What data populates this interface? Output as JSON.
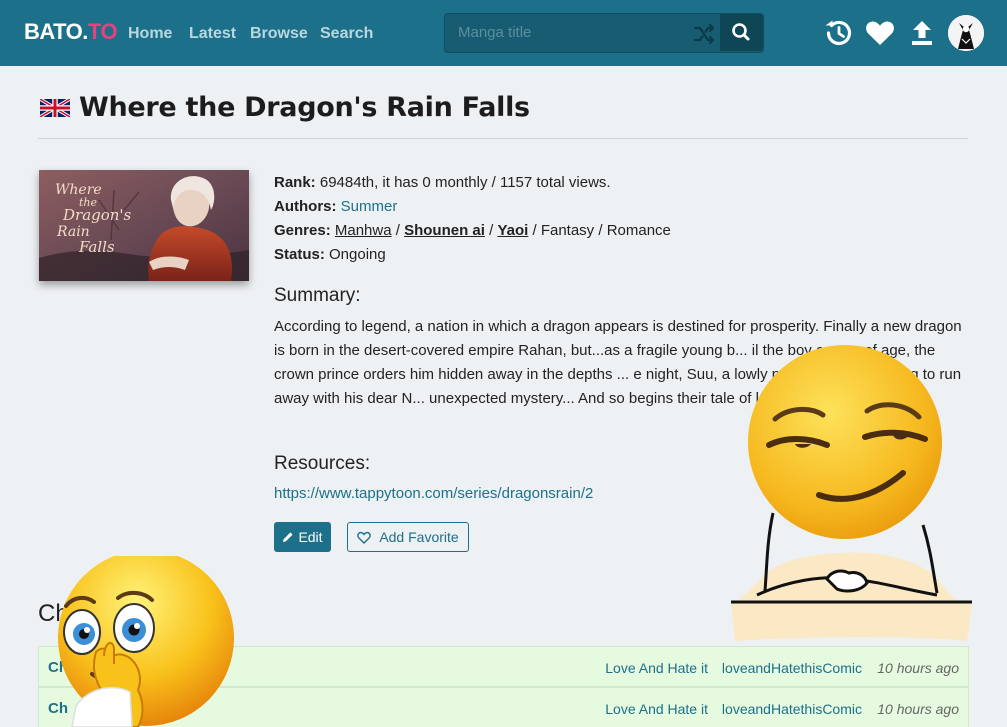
{
  "header": {
    "logo_a": "BATO.",
    "logo_b": "TO",
    "nav": [
      "Home",
      "Latest",
      "Browse",
      "Search"
    ],
    "search_placeholder": "Manga title",
    "icons": [
      "history-icon",
      "heart-icon",
      "upload-icon"
    ]
  },
  "manga": {
    "title": "Where the Dragon's Rain Falls",
    "flag": "uk-flag",
    "cover_text": [
      "Where",
      "the",
      "Dragon's",
      "Rain",
      "Falls"
    ],
    "rank_label": "Rank:",
    "rank_value": "69484th, it has 0 monthly / 1157 total views.",
    "authors_label": "Authors:",
    "author": "Summer",
    "genres_label": "Genres:",
    "genres": [
      "Manhwa",
      "Shounen ai",
      "Yaoi",
      "Fantasy",
      "Romance"
    ],
    "genre_sep": " / ",
    "status_label": "Status:",
    "status": "Ongoing",
    "summary_heading": "Summary:",
    "summary": "According to legend, a nation in which a dragon appears is destined for prosperity. Finally a new dragon is born in the desert-covered empire Rahan, but...as a fragile young b... il the boy comes of age, the crown prince orders him hidden away in the depths ... e night, Suu, a lowly palace servant hoping to run away with his dear N... unexpected mystery... And so begins their tale of love, obsession... a...",
    "resources_heading": "Resources:",
    "resource_link": "https://www.tappytoon.com/series/dragonsrain/2",
    "edit_label": "Edit",
    "favorite_label": "Add Favorite"
  },
  "chapters": {
    "heading": "Ch",
    "rows": [
      {
        "name": "Ch",
        "group": "Love And Hate it",
        "user": "loveandHatethisComic",
        "time": "10 hours ago"
      },
      {
        "name": "Ch",
        "group": "Love And Hate it",
        "user": "loveandHatethisComic",
        "time": "10 hours ago"
      }
    ]
  },
  "colors": {
    "navbar": "#1c7089",
    "accent": "#1c7089",
    "logo_pink": "#e8417e",
    "row_bg": "#e6fae0",
    "page_bg": "#eef1f4"
  }
}
